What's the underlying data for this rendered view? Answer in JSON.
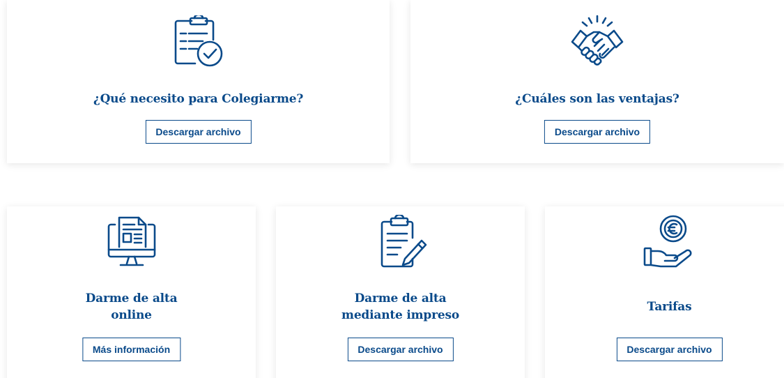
{
  "colors": {
    "accent": "#0a4a8a",
    "card_background": "#ffffff",
    "page_background": "#ffffff"
  },
  "cards": [
    {
      "icon": "clipboard-check-icon",
      "title_lines": [
        "¿Qué necesito para Colegiarme?"
      ],
      "button_label": "Descargar archivo"
    },
    {
      "icon": "handshake-icon",
      "title_lines": [
        "¿Cuáles son las ventajas?"
      ],
      "button_label": "Descargar archivo"
    },
    {
      "icon": "computer-document-icon",
      "title_lines": [
        "Darme de alta",
        "online"
      ],
      "button_label": "Más información"
    },
    {
      "icon": "clipboard-pencil-icon",
      "title_lines": [
        "Darme de alta",
        "mediante impreso"
      ],
      "button_label": "Descargar archivo"
    },
    {
      "icon": "hand-euro-coin-icon",
      "title_lines": [
        "Tarifas"
      ],
      "button_label": "Descargar archivo"
    }
  ]
}
